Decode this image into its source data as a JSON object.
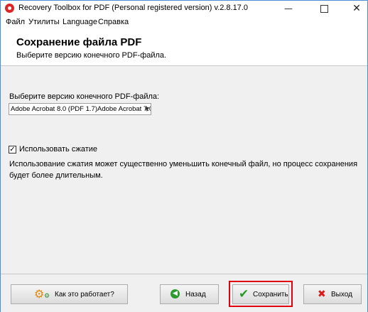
{
  "window": {
    "title": "Recovery Toolbox for PDF (Personal registered version) v.2.8.17.0",
    "minimize": "—",
    "close": "✕"
  },
  "menu": [
    "Файл",
    "Утилиты",
    "Language",
    "Справка"
  ],
  "header": {
    "title": "Сохранение файла PDF",
    "subtitle": "Выберите версию конечного PDF-файла."
  },
  "version": {
    "label": "Выберите версию конечного PDF-файла:",
    "selected": "Adobe Acrobat 8.0 (PDF 1.7)Adobe Acrobat 7.0 (PI"
  },
  "compression": {
    "checked": true,
    "label": "Использовать сжатие",
    "description": "Использование сжатия может существенно уменьшить конечный файл, но процесс сохранения будет более длительным."
  },
  "footer": {
    "help": "Как это работает?",
    "back": "Назад",
    "save": "Сохранить",
    "exit": "Выход"
  },
  "colors": {
    "highlight": "#e0000f",
    "window_border": "#4a8fd6"
  }
}
